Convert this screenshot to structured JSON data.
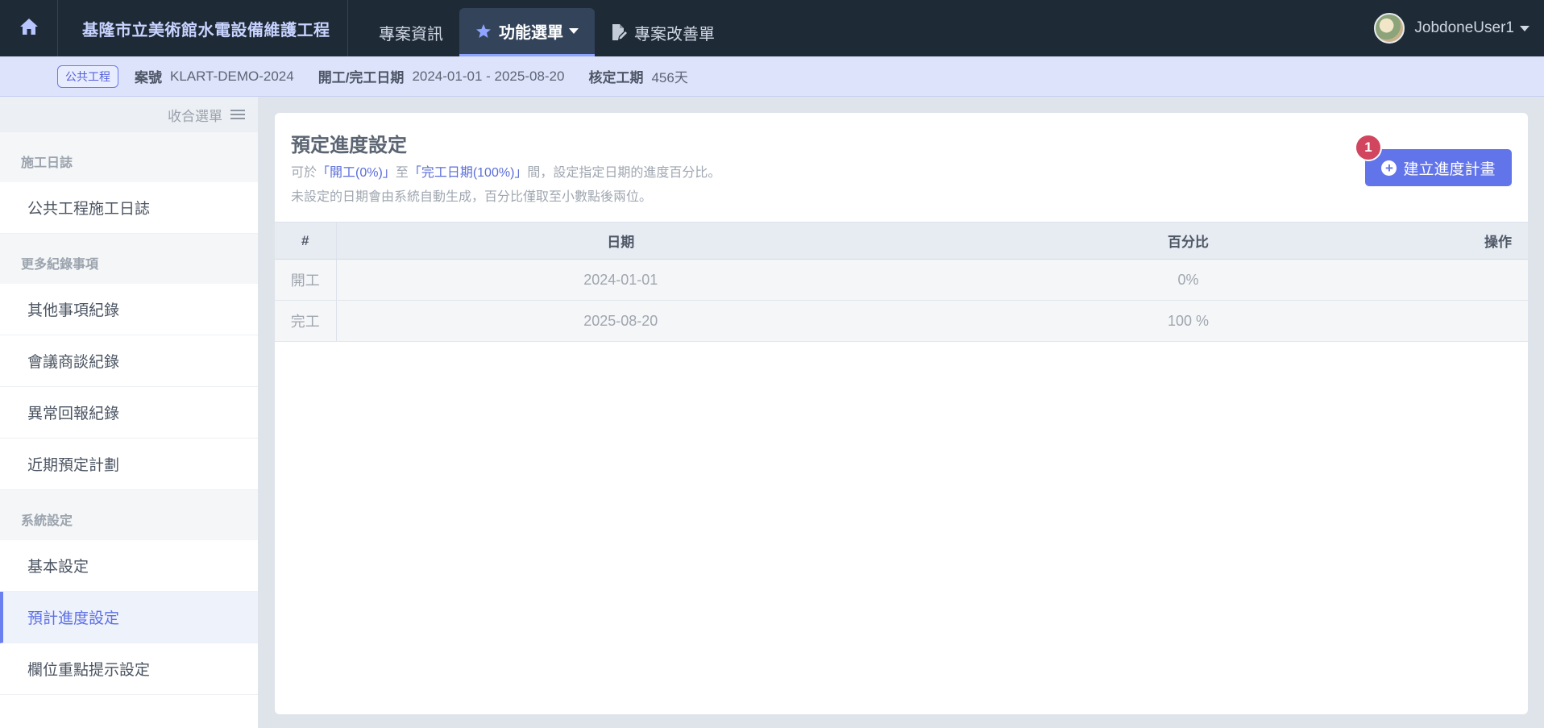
{
  "topnav": {
    "home_icon": "home-icon",
    "brand": "基隆市立美術館水電設備維護工程",
    "tabs": [
      {
        "label": "專案資訊",
        "icon": ""
      },
      {
        "label": "功能選單",
        "icon": "star-icon"
      },
      {
        "label": "專案改善單",
        "icon": "edit-document-icon"
      }
    ],
    "user_name": "JobdoneUser1"
  },
  "infobar": {
    "badge": "公共工程",
    "case_label": "案號",
    "case_value": "KLART-DEMO-2024",
    "date_label": "開工/完工日期",
    "date_value": "2024-01-01 - 2025-08-20",
    "duration_label": "核定工期",
    "duration_value": "456天"
  },
  "sidebar": {
    "collapse_label": "收合選單",
    "sections": [
      {
        "title": "施工日誌",
        "items": [
          "公共工程施工日誌"
        ]
      },
      {
        "title": "更多紀錄事項",
        "items": [
          "其他事項紀錄",
          "會議商談紀錄",
          "異常回報紀錄",
          "近期預定計劃"
        ]
      },
      {
        "title": "系統設定",
        "items": [
          "基本設定",
          "預計進度設定",
          "欄位重點提示設定"
        ]
      }
    ],
    "active_item": "預計進度設定"
  },
  "main": {
    "title": "預定進度設定",
    "desc1_prefix": "可於",
    "desc1_hl1": "「開工(0%)」",
    "desc1_mid": "至",
    "desc1_hl2": "「完工日期(100%)」",
    "desc1_suffix": "間，設定指定日期的進度百分比。",
    "desc2": "未設定的日期會由系統自動生成，百分比僅取至小數點後兩位。",
    "create_button": "建立進度計畫",
    "badge_count": "1",
    "table": {
      "headers": [
        "#",
        "日期",
        "百分比",
        "操作"
      ],
      "rows": [
        [
          "開工",
          "2024-01-01",
          "0%",
          ""
        ],
        [
          "完工",
          "2025-08-20",
          "100 %",
          ""
        ]
      ]
    }
  },
  "colors": {
    "nav_bg": "#1f2a37",
    "accent": "#6274ea",
    "infobar_bg": "#dde3fb",
    "badge_red": "#d1455f"
  }
}
